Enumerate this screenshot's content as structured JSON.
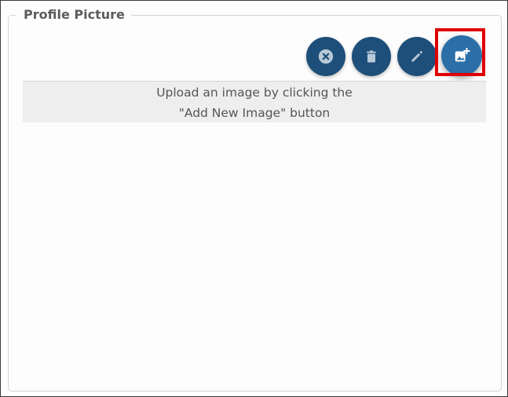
{
  "section": {
    "legend": "Profile Picture"
  },
  "toolbar": {
    "buttons": [
      {
        "icon": "close-circle-icon"
      },
      {
        "icon": "trash-icon"
      },
      {
        "icon": "pencil-icon"
      },
      {
        "icon": "add-image-icon"
      }
    ],
    "highlight_color": "#e00000"
  },
  "empty_state": {
    "line1": "Upload an image by clicking the",
    "line2": "\"Add New Image\" button"
  },
  "colors": {
    "button_dark": "#1e4f7a",
    "button_primary": "#2c6fa8",
    "message_bg": "#eeeeee"
  }
}
